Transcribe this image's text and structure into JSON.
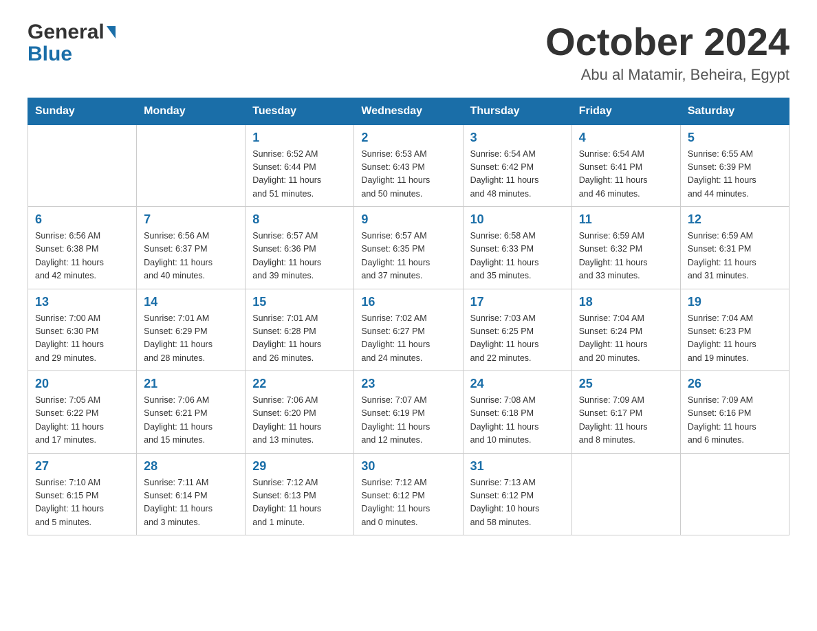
{
  "header": {
    "month_title": "October 2024",
    "location": "Abu al Matamir, Beheira, Egypt",
    "logo_general": "General",
    "logo_blue": "Blue"
  },
  "days_of_week": [
    "Sunday",
    "Monday",
    "Tuesday",
    "Wednesday",
    "Thursday",
    "Friday",
    "Saturday"
  ],
  "weeks": [
    [
      {
        "day": "",
        "info": ""
      },
      {
        "day": "",
        "info": ""
      },
      {
        "day": "1",
        "info": "Sunrise: 6:52 AM\nSunset: 6:44 PM\nDaylight: 11 hours\nand 51 minutes."
      },
      {
        "day": "2",
        "info": "Sunrise: 6:53 AM\nSunset: 6:43 PM\nDaylight: 11 hours\nand 50 minutes."
      },
      {
        "day": "3",
        "info": "Sunrise: 6:54 AM\nSunset: 6:42 PM\nDaylight: 11 hours\nand 48 minutes."
      },
      {
        "day": "4",
        "info": "Sunrise: 6:54 AM\nSunset: 6:41 PM\nDaylight: 11 hours\nand 46 minutes."
      },
      {
        "day": "5",
        "info": "Sunrise: 6:55 AM\nSunset: 6:39 PM\nDaylight: 11 hours\nand 44 minutes."
      }
    ],
    [
      {
        "day": "6",
        "info": "Sunrise: 6:56 AM\nSunset: 6:38 PM\nDaylight: 11 hours\nand 42 minutes."
      },
      {
        "day": "7",
        "info": "Sunrise: 6:56 AM\nSunset: 6:37 PM\nDaylight: 11 hours\nand 40 minutes."
      },
      {
        "day": "8",
        "info": "Sunrise: 6:57 AM\nSunset: 6:36 PM\nDaylight: 11 hours\nand 39 minutes."
      },
      {
        "day": "9",
        "info": "Sunrise: 6:57 AM\nSunset: 6:35 PM\nDaylight: 11 hours\nand 37 minutes."
      },
      {
        "day": "10",
        "info": "Sunrise: 6:58 AM\nSunset: 6:33 PM\nDaylight: 11 hours\nand 35 minutes."
      },
      {
        "day": "11",
        "info": "Sunrise: 6:59 AM\nSunset: 6:32 PM\nDaylight: 11 hours\nand 33 minutes."
      },
      {
        "day": "12",
        "info": "Sunrise: 6:59 AM\nSunset: 6:31 PM\nDaylight: 11 hours\nand 31 minutes."
      }
    ],
    [
      {
        "day": "13",
        "info": "Sunrise: 7:00 AM\nSunset: 6:30 PM\nDaylight: 11 hours\nand 29 minutes."
      },
      {
        "day": "14",
        "info": "Sunrise: 7:01 AM\nSunset: 6:29 PM\nDaylight: 11 hours\nand 28 minutes."
      },
      {
        "day": "15",
        "info": "Sunrise: 7:01 AM\nSunset: 6:28 PM\nDaylight: 11 hours\nand 26 minutes."
      },
      {
        "day": "16",
        "info": "Sunrise: 7:02 AM\nSunset: 6:27 PM\nDaylight: 11 hours\nand 24 minutes."
      },
      {
        "day": "17",
        "info": "Sunrise: 7:03 AM\nSunset: 6:25 PM\nDaylight: 11 hours\nand 22 minutes."
      },
      {
        "day": "18",
        "info": "Sunrise: 7:04 AM\nSunset: 6:24 PM\nDaylight: 11 hours\nand 20 minutes."
      },
      {
        "day": "19",
        "info": "Sunrise: 7:04 AM\nSunset: 6:23 PM\nDaylight: 11 hours\nand 19 minutes."
      }
    ],
    [
      {
        "day": "20",
        "info": "Sunrise: 7:05 AM\nSunset: 6:22 PM\nDaylight: 11 hours\nand 17 minutes."
      },
      {
        "day": "21",
        "info": "Sunrise: 7:06 AM\nSunset: 6:21 PM\nDaylight: 11 hours\nand 15 minutes."
      },
      {
        "day": "22",
        "info": "Sunrise: 7:06 AM\nSunset: 6:20 PM\nDaylight: 11 hours\nand 13 minutes."
      },
      {
        "day": "23",
        "info": "Sunrise: 7:07 AM\nSunset: 6:19 PM\nDaylight: 11 hours\nand 12 minutes."
      },
      {
        "day": "24",
        "info": "Sunrise: 7:08 AM\nSunset: 6:18 PM\nDaylight: 11 hours\nand 10 minutes."
      },
      {
        "day": "25",
        "info": "Sunrise: 7:09 AM\nSunset: 6:17 PM\nDaylight: 11 hours\nand 8 minutes."
      },
      {
        "day": "26",
        "info": "Sunrise: 7:09 AM\nSunset: 6:16 PM\nDaylight: 11 hours\nand 6 minutes."
      }
    ],
    [
      {
        "day": "27",
        "info": "Sunrise: 7:10 AM\nSunset: 6:15 PM\nDaylight: 11 hours\nand 5 minutes."
      },
      {
        "day": "28",
        "info": "Sunrise: 7:11 AM\nSunset: 6:14 PM\nDaylight: 11 hours\nand 3 minutes."
      },
      {
        "day": "29",
        "info": "Sunrise: 7:12 AM\nSunset: 6:13 PM\nDaylight: 11 hours\nand 1 minute."
      },
      {
        "day": "30",
        "info": "Sunrise: 7:12 AM\nSunset: 6:12 PM\nDaylight: 11 hours\nand 0 minutes."
      },
      {
        "day": "31",
        "info": "Sunrise: 7:13 AM\nSunset: 6:12 PM\nDaylight: 10 hours\nand 58 minutes."
      },
      {
        "day": "",
        "info": ""
      },
      {
        "day": "",
        "info": ""
      }
    ]
  ]
}
